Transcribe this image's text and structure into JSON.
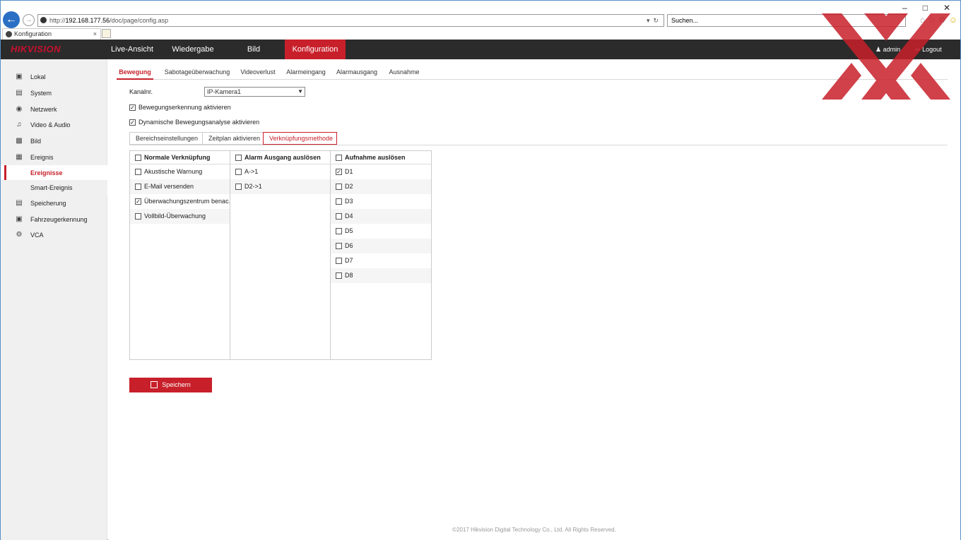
{
  "browser": {
    "url_prefix": "http://",
    "url_host": "192.168.177.56",
    "url_path": "/doc/page/config.asp",
    "search_placeholder": "Suchen...",
    "tab_title": "Konfiguration",
    "tab_close": "×"
  },
  "topnav": {
    "logo": "HIKVISION",
    "items": [
      "Live-Ansicht",
      "Wiedergabe",
      "Bild",
      "Konfiguration"
    ],
    "active": "Konfiguration",
    "user": "admin",
    "logout": "Logout"
  },
  "sidebar": {
    "items": [
      {
        "label": "Lokal",
        "icon": "monitor-icon"
      },
      {
        "label": "System",
        "icon": "system-icon"
      },
      {
        "label": "Netzwerk",
        "icon": "globe-icon"
      },
      {
        "label": "Video & Audio",
        "icon": "audio-icon"
      },
      {
        "label": "Bild",
        "icon": "image-icon"
      },
      {
        "label": "Ereignis",
        "icon": "calendar-icon"
      },
      {
        "label": "Ereignisse",
        "icon": ""
      },
      {
        "label": "Smart-Ereignis",
        "icon": ""
      },
      {
        "label": "Speicherung",
        "icon": "storage-icon"
      },
      {
        "label": "Fahrzeugerkennung",
        "icon": "vehicle-icon"
      },
      {
        "label": "VCA",
        "icon": "vca-icon"
      }
    ],
    "active": "Ereignisse"
  },
  "subtabs": [
    "Bewegung",
    "Sabotageüberwachung",
    "Videoverlust",
    "Alarmeingang",
    "Alarmausgang",
    "Ausnahme"
  ],
  "subtabs_active": "Bewegung",
  "form": {
    "channel_label": "Kanalnr.",
    "channel_value": "IP-Kamera1",
    "enable_motion": {
      "label": "Bewegungserkennung aktivieren",
      "checked": true
    },
    "dynamic_analysis": {
      "label": "Dynamische Bewegungsanalyse aktivieren",
      "checked": true
    }
  },
  "steps": [
    "Bereichseinstellungen",
    "Zeitplan aktivieren",
    "Verknüpfungsmethode"
  ],
  "steps_active": "Verknüpfungsmethode",
  "linkage": {
    "normal": {
      "header": "Normale Verknüpfung",
      "items": [
        {
          "label": "Akustische Warnung",
          "checked": false
        },
        {
          "label": "E-Mail versenden",
          "checked": false
        },
        {
          "label": "Überwachungszentrum benac...",
          "checked": true
        },
        {
          "label": "Vollbild-Überwachung",
          "checked": false
        }
      ]
    },
    "alarm": {
      "header": "Alarm Ausgang auslösen",
      "items": [
        {
          "label": "A->1",
          "checked": false
        },
        {
          "label": "D2->1",
          "checked": false
        }
      ]
    },
    "record": {
      "header": "Aufnahme auslösen",
      "items": [
        {
          "label": "D1",
          "checked": true
        },
        {
          "label": "D2",
          "checked": false
        },
        {
          "label": "D3",
          "checked": false
        },
        {
          "label": "D4",
          "checked": false
        },
        {
          "label": "D5",
          "checked": false
        },
        {
          "label": "D6",
          "checked": false
        },
        {
          "label": "D7",
          "checked": false
        },
        {
          "label": "D8",
          "checked": false
        }
      ]
    }
  },
  "save_label": "Speichern",
  "footer": "©2017 Hikvision Digital Technology Co., Ltd. All Rights Reserved.",
  "colors": {
    "accent": "#c8202a",
    "topbar": "#2b2b2b",
    "sidebar": "#f0f0f0"
  }
}
